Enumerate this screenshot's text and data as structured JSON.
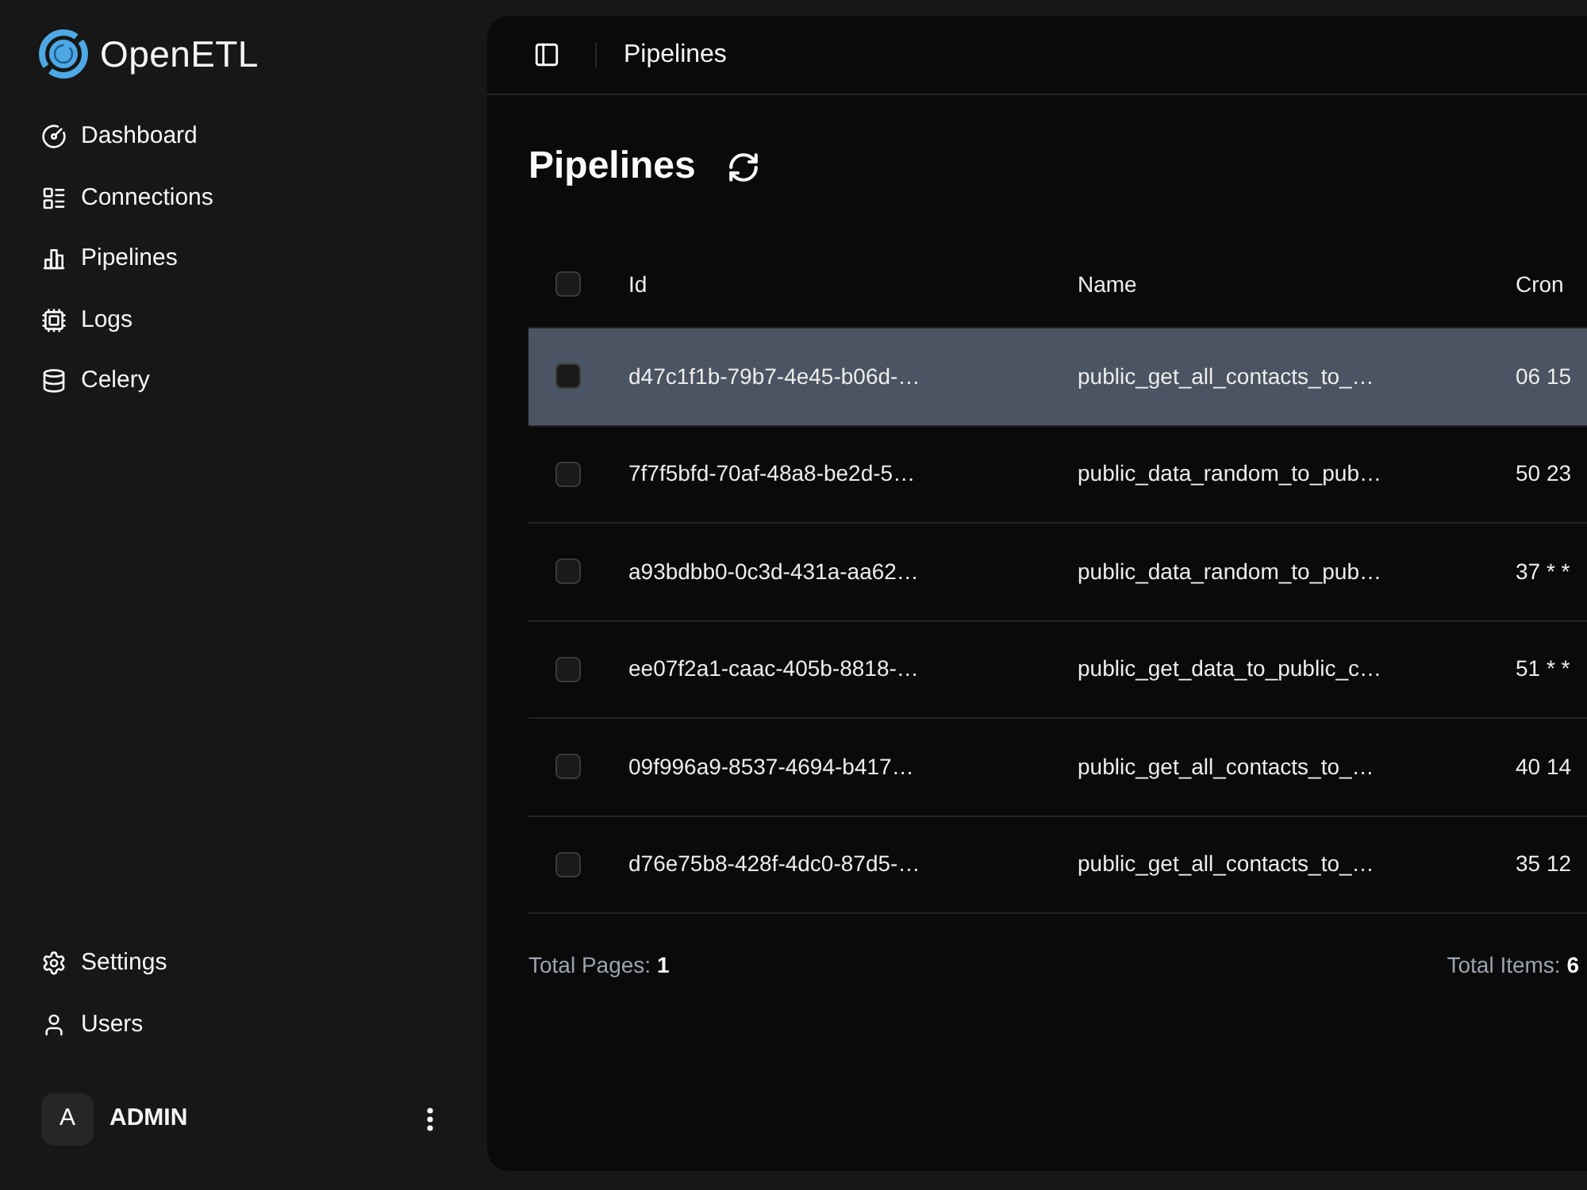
{
  "app": {
    "name": "OpenETL"
  },
  "sidebar": {
    "items": [
      {
        "label": "Dashboard",
        "selected": false
      },
      {
        "label": "Connections",
        "selected": false
      },
      {
        "label": "Pipelines",
        "selected": false
      },
      {
        "label": "Logs",
        "selected": false
      },
      {
        "label": "Celery",
        "selected": false
      }
    ],
    "bottom_items": [
      {
        "label": "Settings",
        "selected": false
      },
      {
        "label": "Users",
        "selected": false
      }
    ],
    "user": {
      "initial": "A",
      "name": "ADMIN"
    }
  },
  "header": {
    "breadcrumb": "Pipelines"
  },
  "page": {
    "title": "Pipelines"
  },
  "table": {
    "columns": [
      "Id",
      "Name",
      "Cron"
    ],
    "select_all": {
      "checked": false
    },
    "rows": [
      {
        "selected": true,
        "checked": false,
        "cells": [
          "d47c1f1b-79b7-4e45-b06d-…",
          "public_get_all_contacts_to_…",
          "06 15"
        ]
      },
      {
        "selected": false,
        "checked": false,
        "cells": [
          "7f7f5bfd-70af-48a8-be2d-5…",
          "public_data_random_to_pub…",
          "50 23"
        ]
      },
      {
        "selected": false,
        "checked": false,
        "cells": [
          "a93bdbb0-0c3d-431a-aa62…",
          "public_data_random_to_pub…",
          "37 * *"
        ]
      },
      {
        "selected": false,
        "checked": false,
        "cells": [
          "ee07f2a1-caac-405b-8818-…",
          "public_get_data_to_public_c…",
          "51 * *"
        ]
      },
      {
        "selected": false,
        "checked": false,
        "cells": [
          "09f996a9-8537-4694-b417…",
          "public_get_all_contacts_to_…",
          "40 14"
        ]
      },
      {
        "selected": false,
        "checked": false,
        "cells": [
          "d76e75b8-428f-4dc0-87d5-…",
          "public_get_all_contacts_to_…",
          "35 12"
        ]
      }
    ]
  },
  "footer": {
    "total_pages": "Total Pages: **1**",
    "total_items": "Total Items: **6**"
  }
}
